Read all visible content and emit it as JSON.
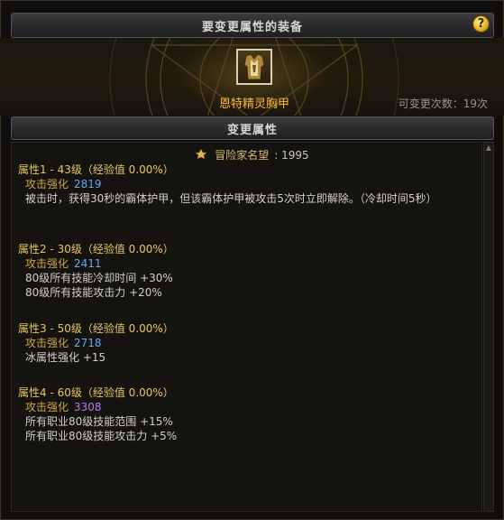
{
  "header": {
    "title": "要变更属性的装备",
    "help_icon": "?"
  },
  "item": {
    "name": "恩特精灵胸甲",
    "change_count": "可变更次数：19次",
    "icon": "elven-chest-armor-icon"
  },
  "subheader": {
    "title": "变更属性"
  },
  "fame": {
    "label": "冒险家名望",
    "value": ": 1995"
  },
  "attributes": [
    {
      "title": "属性1 - 43级（经验值 0.00%）",
      "sub_label": "攻击强化",
      "sub_value": "2819",
      "lines": [
        "被击时，获得30秒的霸体护甲，但该霸体护甲被攻击5次时立即解除。（冷却时间5秒）"
      ]
    },
    {
      "title": "属性2 - 30级（经验值 0.00%）",
      "sub_label": "攻击强化",
      "sub_value": "2411",
      "lines": [
        "80级所有技能冷却时间 +30%",
        "80级所有技能攻击力 +20%"
      ]
    },
    {
      "title": "属性3 - 50级（经验值 0.00%）",
      "sub_label": "攻击强化",
      "sub_value": "2718",
      "lines": [
        "冰属性强化 +15"
      ]
    },
    {
      "title": "属性4 - 60级（经验值 0.00%）",
      "sub_label": "攻击强化",
      "sub_value": "3308",
      "lines": [
        "所有职业80级技能范围 +15%",
        "所有职业80级技能攻击力 +5%"
      ]
    }
  ],
  "colors": {
    "gold_title": "#e6c760",
    "orange_label": "#d2a64a",
    "blue_value": "#6aa8e8",
    "purple_value": "#b477ea",
    "item_name": "#ffb83a"
  }
}
